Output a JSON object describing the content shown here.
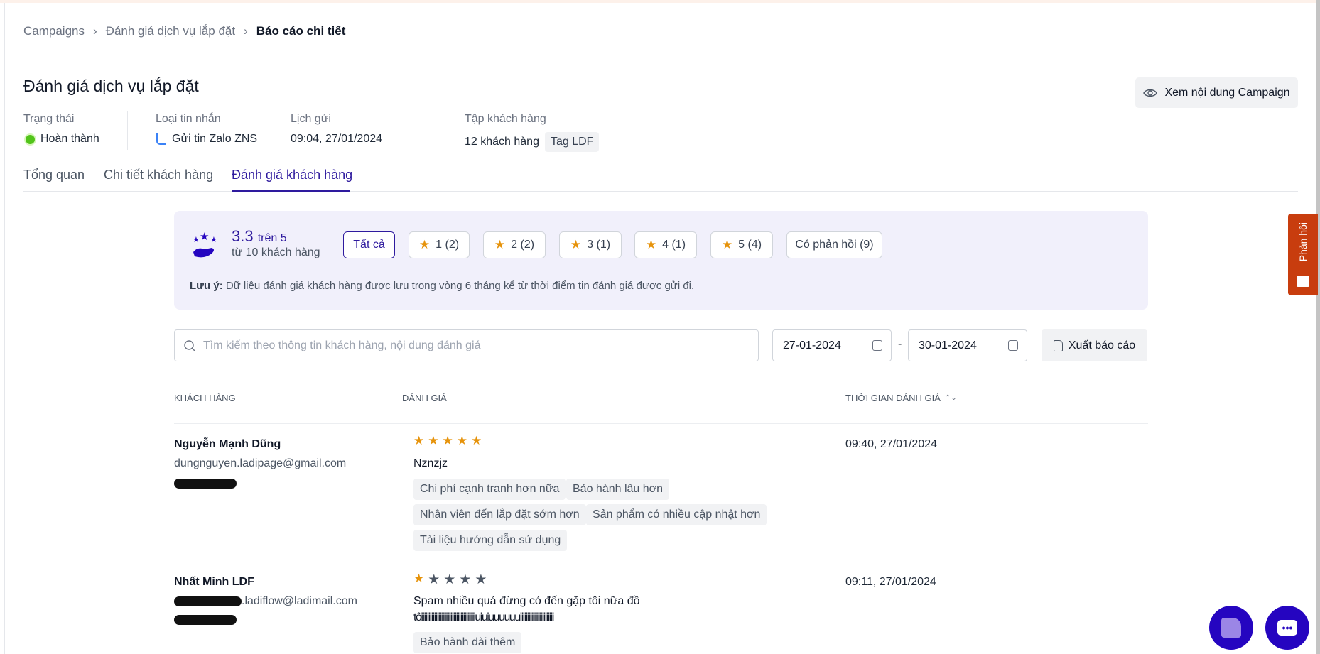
{
  "breadcrumb": [
    "Campaigns",
    "Đánh giá dịch vụ lắp đặt",
    "Báo cáo chi tiết"
  ],
  "title": "Đánh giá dịch vụ lắp đặt",
  "view_button": "Xem nội dung Campaign",
  "meta": {
    "status_label": "Trạng thái",
    "status_value": "Hoàn thành",
    "type_label": "Loại tin nhắn",
    "type_value": "Gửi tin Zalo ZNS",
    "schedule_label": "Lịch gửi",
    "schedule_value": "09:04, 27/01/2024",
    "audience_label": "Tập khách hàng",
    "audience_value": "12 khách hàng",
    "audience_tag": "Tag LDF"
  },
  "tabs": [
    "Tổng quan",
    "Chi tiết khách hàng",
    "Đánh giá khách hàng"
  ],
  "summary": {
    "score": "3.3",
    "score_suffix": "trên 5",
    "from": "từ 10 khách hàng",
    "filters": [
      "Tất cả",
      "1 (2)",
      "2 (2)",
      "3 (1)",
      "4 (1)",
      "5 (4)",
      "Có phản hồi (9)"
    ],
    "note_label": "Lưu ý:",
    "note": "Dữ liệu đánh giá khách hàng được lưu trong vòng 6 tháng kể từ thời điểm tin đánh giá được gửi đi."
  },
  "search_placeholder": "Tìm kiếm theo thông tin khách hàng, nội dung đánh giá",
  "date_from": "27-01-2024",
  "date_sep": "-",
  "date_to": "30-01-2024",
  "export_button": "Xuất báo cáo",
  "table": {
    "headers": [
      "KHÁCH HÀNG",
      "ĐÁNH GIÁ",
      "THỜI GIAN ĐÁNH GIÁ"
    ],
    "rows": [
      {
        "name": "Nguyễn Mạnh Dũng",
        "email": "dungnguyen.ladipage@gmail.com",
        "rating": 5,
        "comment": "Nznzjz",
        "comment2": "",
        "tags": [
          "Chi phí cạnh tranh hơn nữa",
          "Bảo hành lâu hơn",
          "Nhân viên đến lắp đặt sớm hơn",
          "Sản phẩm có nhiều cập nhật hơn",
          "Tài liệu hướng dẫn sử dụng"
        ],
        "time": "09:40, 27/01/2024"
      },
      {
        "name": "Nhất Minh LDF",
        "email": ".ladiflow@ladimail.com",
        "rating": 1,
        "comment": "Spam nhiều quá đừng có đến gặp tôi nữa đồ",
        "comment2": "tôiiiiiiiiiiiiiiiiiiiiiiiiiiiiiiiiiiiiiuiuiuuuuuuiiiiiiiiiiiiiiiiiiiiiii",
        "tags": [
          "Bảo hành dài thêm"
        ],
        "time": "09:11, 27/01/2024"
      }
    ]
  },
  "feedback_tab": "Phản hồi",
  "colors": {
    "accent": "#2e1a9e",
    "star": "#e6930b",
    "feedback": "#c83d0e",
    "fab": "#2505c0"
  }
}
